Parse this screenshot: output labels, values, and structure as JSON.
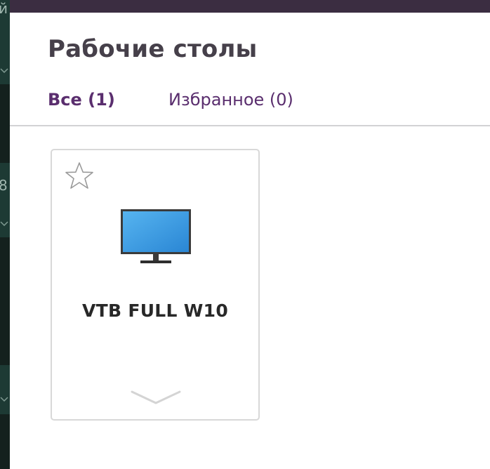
{
  "background_fragments": {
    "glyph_1": "й",
    "glyph_2": "8"
  },
  "page": {
    "title": "Рабочие столы"
  },
  "tabs": [
    {
      "label": "Все (1)",
      "active": true
    },
    {
      "label": "Избранное (0)",
      "active": false
    }
  ],
  "desktops": [
    {
      "name": "VTB FULL W10",
      "favorite": false,
      "icon": "monitor-icon"
    }
  ],
  "colors": {
    "top_bar": "#3b2d41",
    "title_text": "#46404a",
    "tab_text": "#5a2e6e",
    "card_border": "#d8d8d8",
    "monitor_screen": "#3a9ee8"
  }
}
